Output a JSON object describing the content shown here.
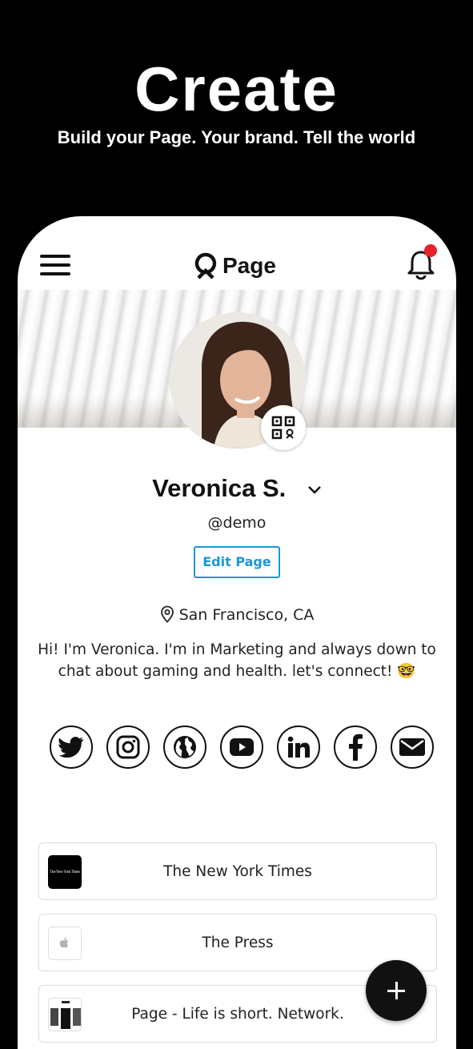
{
  "promo": {
    "title": "Create",
    "subtitle": "Build your Page. Your brand. Tell the world"
  },
  "appbar": {
    "brand": "Page",
    "menu_icon": "hamburger-menu-icon",
    "notification_icon": "bell-icon",
    "notification_dot_color": "#e8202a"
  },
  "profile": {
    "name": "Veronica S.",
    "handle": "@demo",
    "edit_label": "Edit Page",
    "location": "San Francisco, CA",
    "bio": "Hi! I'm Veronica. I'm in Marketing and always down to chat about gaming and health. let's connect! 🤓",
    "accent_color": "#1a96d8"
  },
  "socials": [
    {
      "name": "twitter",
      "icon": "twitter-icon"
    },
    {
      "name": "instagram",
      "icon": "instagram-icon"
    },
    {
      "name": "website",
      "icon": "globe-icon"
    },
    {
      "name": "youtube",
      "icon": "youtube-icon"
    },
    {
      "name": "linkedin",
      "icon": "linkedin-icon"
    },
    {
      "name": "facebook",
      "icon": "facebook-icon"
    },
    {
      "name": "email",
      "icon": "mail-icon"
    }
  ],
  "links": [
    {
      "label": "The New York Times",
      "thumb": "The New York Times"
    },
    {
      "label": "The Press",
      "thumb": "apple-icon"
    },
    {
      "label": "Page - Life is short. Network.",
      "thumb": "page-screenshot"
    }
  ],
  "fab": {
    "icon": "plus-icon"
  }
}
